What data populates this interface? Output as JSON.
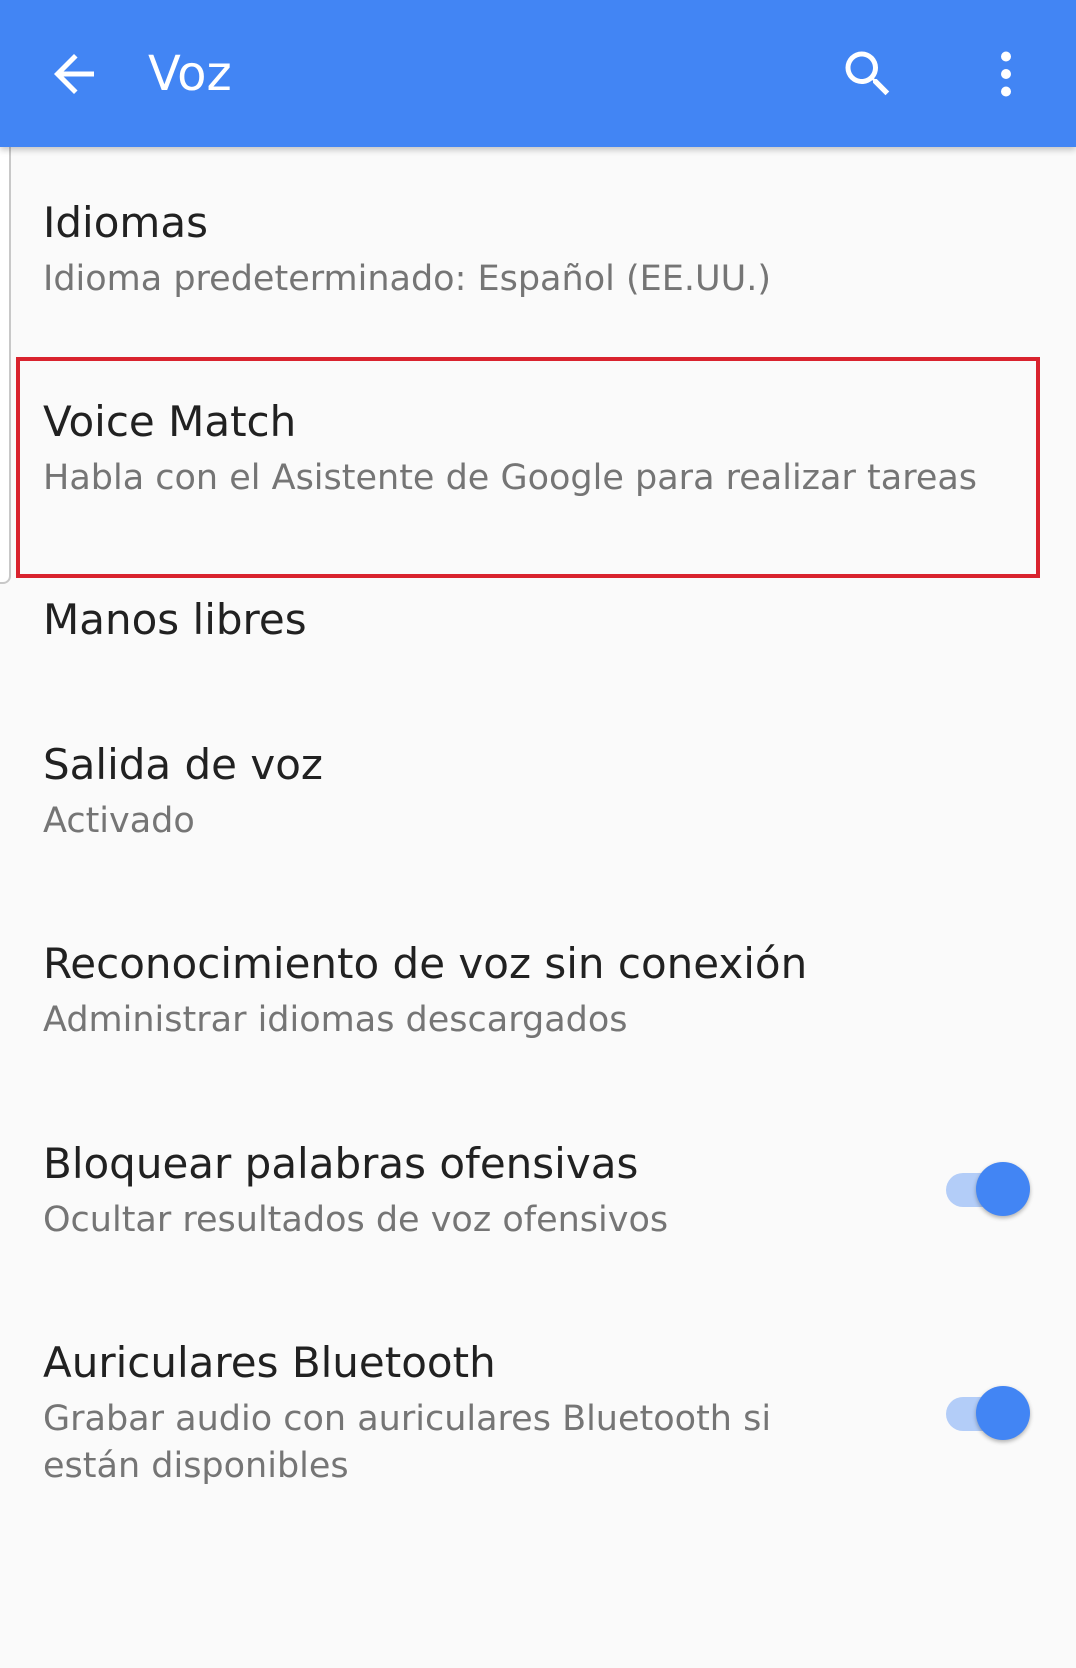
{
  "appbar": {
    "title": "Voz",
    "background": "#4285f4",
    "icons": [
      "arrow-back-icon",
      "search-icon",
      "more-vert-icon"
    ]
  },
  "settings": [
    {
      "title": "Idiomas",
      "subtitle": "Idioma predeterminado: Español (EE.UU.)"
    },
    {
      "title": "Voice Match",
      "subtitle": "Habla con el Asistente de Google para realizar tareas",
      "highlighted": true
    },
    {
      "title": "Manos libres"
    },
    {
      "title": "Salida de voz",
      "subtitle": "Activado"
    },
    {
      "title": "Reconocimiento de voz sin conexión",
      "subtitle": "Administrar idiomas descargados"
    },
    {
      "title": "Bloquear palabras ofensivas",
      "subtitle": "Ocultar resultados de voz ofensivos",
      "toggle_on": true
    },
    {
      "title": "Auriculares Bluetooth",
      "subtitle_line1": "Grabar audio con auriculares Bluetooth si",
      "subtitle_line2": "están disponibles",
      "toggle_on": true
    }
  ],
  "colors": {
    "accent": "#4285f4",
    "highlight_border": "#d9232e",
    "title_text": "#212121",
    "subtitle_text": "#757575"
  }
}
